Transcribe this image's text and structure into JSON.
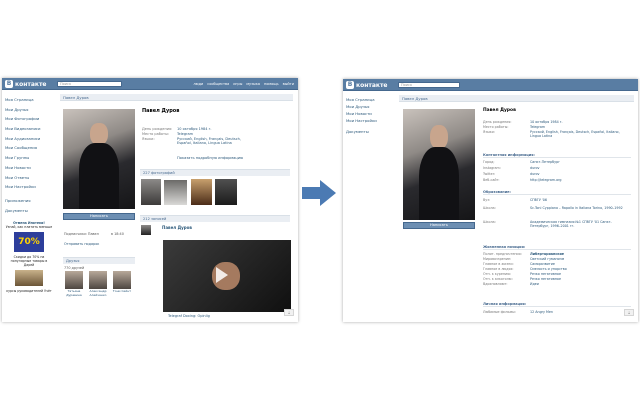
{
  "colors": {
    "header": "#597da3",
    "link": "#2b587a",
    "accent_arrow": "#4b7ab3",
    "ad_banner": "#2d3e9b"
  },
  "left": {
    "brand": "контакте",
    "brand_mark": "В",
    "search_placeholder": "Поиск",
    "top_nav": [
      "люди",
      "сообщества",
      "игры",
      "музыка",
      "помощь",
      "выйти"
    ],
    "sidebar": [
      "Моя Страница",
      "Мои Друзья",
      "Мои Фотографии",
      "Мои Видеозаписи",
      "Мои Аудиозаписи",
      "Мои Сообщения",
      "Мои Группы",
      "Мои Новости",
      "Мои Ответы",
      "Мои Настройки"
    ],
    "sidebar_extra": [
      "Приложения",
      "Документы"
    ],
    "ad": {
      "title": "Отмена Ипотеки!",
      "caption": "Узнай, как платить меньше",
      "banner_text": "70%",
      "text2": "Скидки до 70% на популярные товары в Дарей",
      "text3": "курсы руководителей Учёт"
    },
    "crumb": "Павел Дуров",
    "profile": {
      "name": "Павел Дуров",
      "status": "",
      "rows": [
        {
          "k": "День рождения:",
          "v": "10 октября 1984 г."
        },
        {
          "k": "Место работы:",
          "v": "Telegram"
        },
        {
          "k": "Языки:",
          "v": "Русский, English, Français, Deutsch, Español, Italiano, Lingua Latina"
        }
      ],
      "show_more": "Показать подробную информацию",
      "write_button": "Написать",
      "photos_head": "227 фотографий",
      "wall_head": "212 записей",
      "wall_name": "Павел Дуров",
      "video_title": "Telegraf Doxing: Opinlig",
      "friends_head": "Друзья",
      "friends_count": "770 друзей",
      "friends": [
        {
          "name": "Татьяна Дуревина"
        },
        {
          "name": "Александр Алейчанко"
        },
        {
          "name": "Тони Сейнт"
        }
      ],
      "subscribe_note": "Подписчики: Павел",
      "send_gift": "Отправить подарок",
      "time_note": "в 18:40"
    }
  },
  "right": {
    "brand": "контакте",
    "brand_mark": "В",
    "search_placeholder": "Поиск",
    "sidebar": [
      "Моя Страница",
      "Мои Друзья",
      "Мои Новости",
      "Мои Настройки"
    ],
    "sidebar_extra": [
      "Документы"
    ],
    "crumb": "Павел Дуров",
    "profile": {
      "name": "Павел Дуров",
      "write_button": "Написать",
      "rows": [
        {
          "k": "День рождения:",
          "v": "10 октября 1984 г."
        },
        {
          "k": "Место работы:",
          "v": "Telegram"
        },
        {
          "k": "Языки:",
          "v": "Русский, English, Français, Deutsch, Español, Italiano, Lingua Latina"
        }
      ],
      "contact_label": "Контактная информация:",
      "contact_rows": [
        {
          "k": "Город:",
          "v": "Санкт-Петербург"
        },
        {
          "k": "Instagram:",
          "v": "durov"
        },
        {
          "k": "Twitter:",
          "v": "durov"
        },
        {
          "k": "Веб-сайт:",
          "v": "http://telegram.org"
        }
      ],
      "education_label": "Образование:",
      "education_rows": [
        {
          "k": "Вуз:",
          "v": "СПбГУ '06"
        },
        {
          "k": "Школа:",
          "v": "Sc.Toni Cyppiano – Rapallo in Italiana Torino, 1990–1992"
        },
        {
          "k": "Школа:",
          "v": "Академическая гимназия №1 СПбГУ '01 Санкт-Петербург, 1996–2001 гг."
        }
      ],
      "beliefs_label": "Жизненная позиция:",
      "beliefs_rows": [
        {
          "k": "Полит. предпочтения:",
          "v": "Либертарианские"
        },
        {
          "k": "Мировоззрение:",
          "v": "Светский гуманизм"
        },
        {
          "k": "Главное в жизни:",
          "v": "Саморазвитие"
        },
        {
          "k": "Главное в людях:",
          "v": "Смелость и упорство"
        },
        {
          "k": "Отн. к курению:",
          "v": "Резко негативное"
        },
        {
          "k": "Отн. к алкоголю:",
          "v": "Резко негативное"
        },
        {
          "k": "Вдохновляют:",
          "v": "Идеи"
        }
      ],
      "personal_label": "Личная информация:",
      "personal_rows": [
        {
          "k": "Любимые фильмы:",
          "v": "12 Angry Men"
        }
      ]
    }
  }
}
